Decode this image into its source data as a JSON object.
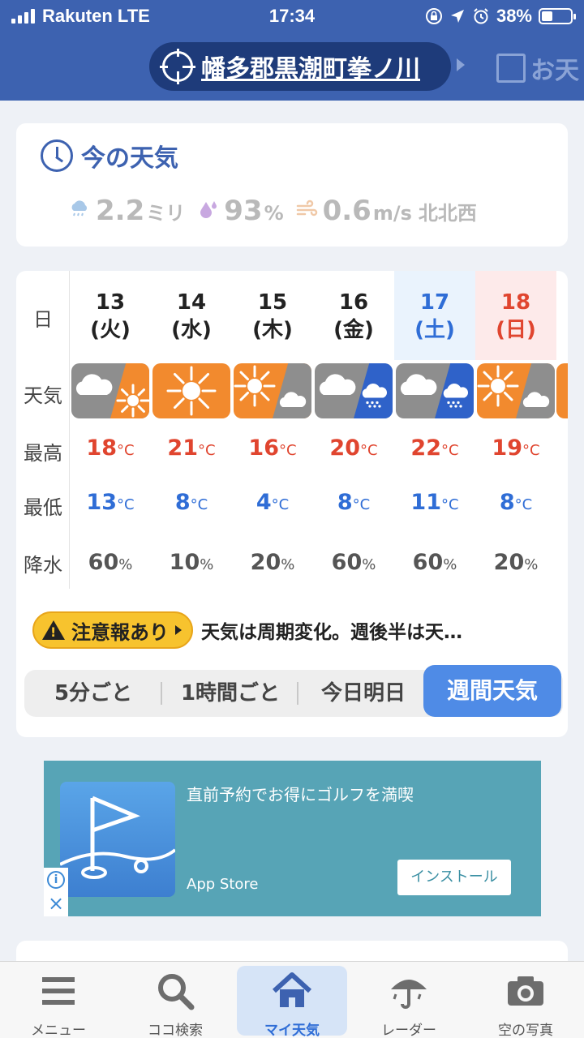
{
  "status": {
    "carrier": "Rakuten  LTE",
    "time": "17:34",
    "battery": "38%",
    "battery_level": 0.38
  },
  "header": {
    "location": "幡多郡黒潮町拳ノ川",
    "news_label": "お天"
  },
  "now": {
    "title": "今の天気",
    "precip_value": "2.2",
    "precip_unit": "ミリ",
    "humidity_value": "93",
    "humidity_unit": "%",
    "wind_value": "0.6",
    "wind_unit": "m/s",
    "wind_dir": "北北西"
  },
  "forecast": {
    "row_labels": {
      "day": "日",
      "weather": "天気",
      "high": "最高",
      "low": "最低",
      "rain": "降水"
    },
    "deg_unit": "°C",
    "pct_unit": "%",
    "days": [
      {
        "date": "13",
        "dow": "(火)",
        "weather": "cloudy-then-sunny",
        "high": "18",
        "low": "13",
        "rain": "60"
      },
      {
        "date": "14",
        "dow": "(水)",
        "weather": "sunny",
        "high": "21",
        "low": "8",
        "rain": "10"
      },
      {
        "date": "15",
        "dow": "(木)",
        "weather": "sunny-then-cloudy",
        "high": "16",
        "low": "4",
        "rain": "20"
      },
      {
        "date": "16",
        "dow": "(金)",
        "weather": "cloudy-then-rain",
        "high": "20",
        "low": "8",
        "rain": "60"
      },
      {
        "date": "17",
        "dow": "(土)",
        "weather": "cloudy-then-rain",
        "high": "22",
        "low": "11",
        "rain": "60"
      },
      {
        "date": "18",
        "dow": "(日)",
        "weather": "sunny-then-cloudy",
        "high": "19",
        "low": "8",
        "rain": "20"
      }
    ]
  },
  "warning": {
    "badge": "注意報あり",
    "text": "天気は周期変化。週後半は天…"
  },
  "tabs": [
    "5分ごと",
    "1時間ごと",
    "今日明日",
    "週間天気"
  ],
  "ad": {
    "title": "直前予約でお得にゴルフを満喫",
    "store": "App Store",
    "install": "インストール"
  },
  "bottom_nav": [
    "メニュー",
    "ココ検索",
    "マイ天気",
    "レーダー",
    "空の写真"
  ]
}
